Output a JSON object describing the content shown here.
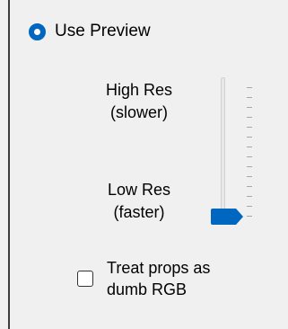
{
  "preview": {
    "option_label": "Use Preview",
    "selected": true
  },
  "resolution": {
    "high_line1": "High Res",
    "high_line2": "(slower)",
    "low_line1": "Low Res",
    "low_line2": "(faster)",
    "slider_level": 0
  },
  "props": {
    "line1": "Treat props as",
    "line2": "dumb RGB",
    "checked": false
  },
  "colors": {
    "accent": "#0067c0",
    "background": "#f0f0f0"
  },
  "icons": {
    "radio": "radio-selected-icon",
    "thumb": "slider-thumb-arrow-icon"
  }
}
